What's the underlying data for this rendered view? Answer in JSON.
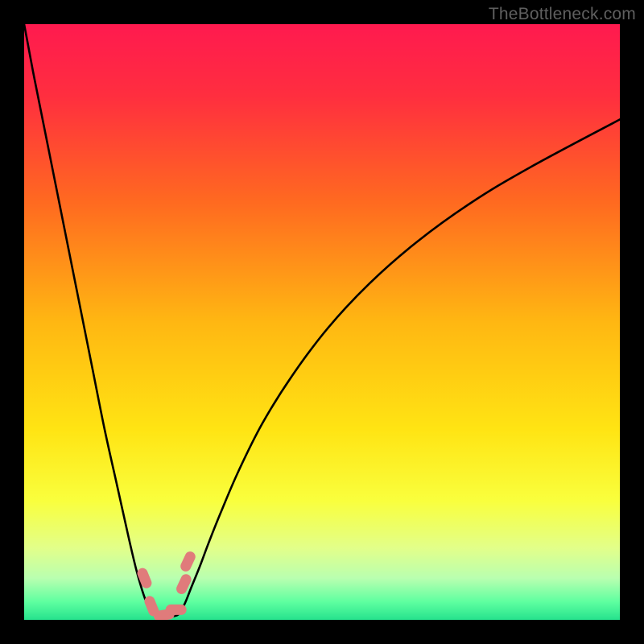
{
  "watermark": "TheBottleneck.com",
  "gradient_stops": [
    {
      "offset": 0.0,
      "color": "#ff1a4f"
    },
    {
      "offset": 0.12,
      "color": "#ff2e3f"
    },
    {
      "offset": 0.3,
      "color": "#ff6a20"
    },
    {
      "offset": 0.5,
      "color": "#ffb712"
    },
    {
      "offset": 0.68,
      "color": "#ffe413"
    },
    {
      "offset": 0.8,
      "color": "#f9ff3d"
    },
    {
      "offset": 0.88,
      "color": "#e2ff8a"
    },
    {
      "offset": 0.93,
      "color": "#b9ffb0"
    },
    {
      "offset": 0.97,
      "color": "#5effa0"
    },
    {
      "offset": 1.0,
      "color": "#26e28d"
    }
  ],
  "chart_data": {
    "type": "line",
    "title": "",
    "xlabel": "",
    "ylabel": "",
    "xlim": [
      0,
      100
    ],
    "ylim": [
      0,
      100
    ],
    "series": [
      {
        "name": "left-branch",
        "x": [
          0.0,
          1.5,
          3.5,
          5.5,
          7.5,
          9.5,
          11.5,
          13.5,
          15.5,
          17.5,
          18.8,
          19.8,
          20.7,
          21.5
        ],
        "y": [
          100,
          92,
          82,
          72,
          62,
          52,
          42,
          32,
          23,
          14,
          8.5,
          5.0,
          2.5,
          1.0
        ]
      },
      {
        "name": "right-branch",
        "x": [
          26.0,
          27.0,
          28.0,
          29.5,
          31.0,
          33.0,
          36.0,
          40.0,
          45.0,
          51.0,
          58.0,
          66.0,
          75.0,
          85.0,
          100.0
        ],
        "y": [
          1.0,
          2.8,
          5.3,
          9.0,
          13.0,
          18.0,
          25.0,
          33.0,
          41.0,
          49.0,
          56.5,
          63.5,
          70.0,
          76.0,
          84.0
        ]
      },
      {
        "name": "valley-floor",
        "x": [
          21.5,
          22.5,
          23.5,
          24.5,
          25.5,
          26.0
        ],
        "y": [
          1.0,
          0.6,
          0.5,
          0.5,
          0.7,
          1.0
        ]
      }
    ],
    "markers": [
      {
        "x": 20.2,
        "y": 7.0
      },
      {
        "x": 21.4,
        "y": 2.3
      },
      {
        "x": 23.5,
        "y": 0.8
      },
      {
        "x": 25.5,
        "y": 1.7
      },
      {
        "x": 26.8,
        "y": 6.0
      },
      {
        "x": 27.5,
        "y": 9.8
      }
    ]
  }
}
